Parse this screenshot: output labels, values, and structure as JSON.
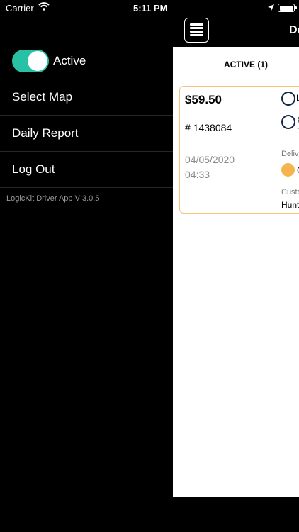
{
  "status_bar": {
    "carrier": "Carrier",
    "time": "5:11 PM"
  },
  "side_menu": {
    "active_toggle_on": true,
    "active_label": "Active",
    "items": [
      {
        "label": "Select Map"
      },
      {
        "label": "Daily Report"
      },
      {
        "label": "Log Out"
      }
    ],
    "version": "LogicKit Driver App V  3.0.5"
  },
  "header": {
    "title_fragment": "De"
  },
  "tabs": {
    "active_label": "ACTIVE (1)"
  },
  "order": {
    "price": "$59.50",
    "number": "# 1438084",
    "date": "04/05/2020",
    "time": "04:33",
    "stop1_fragment": "L",
    "stop2_fragment_a": "8",
    "stop2_fragment_b": "1",
    "delivery_label_fragment": "Deliv",
    "status_fragment": "C",
    "customer_label_fragment": "Custo",
    "customer_name_fragment": "Hunt"
  },
  "colors": {
    "toggle_on": "#27c2a6",
    "card_border": "#f4c57a",
    "status_dot": "#f7b34d",
    "circle_stroke": "#142a4a"
  }
}
